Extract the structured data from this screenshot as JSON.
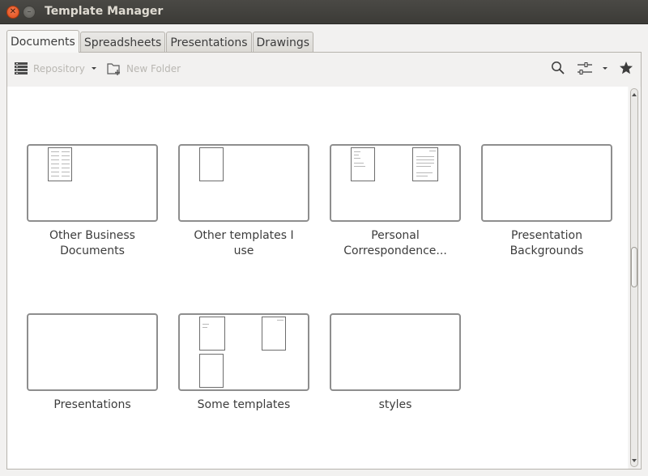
{
  "window": {
    "title": "Template Manager",
    "close_glyph": "✕",
    "min_glyph": "–"
  },
  "tabs": [
    {
      "label": "Documents",
      "active": true
    },
    {
      "label": "Spreadsheets",
      "active": false
    },
    {
      "label": "Presentations",
      "active": false
    },
    {
      "label": "Drawings",
      "active": false
    }
  ],
  "toolbar": {
    "repository_label": "Repository",
    "new_folder_label": "New Folder",
    "icons": [
      "list-icon",
      "chevron-down-icon",
      "new-folder-icon",
      "search-icon",
      "settings-sliders-icon",
      "chevron-down-icon",
      "star-icon"
    ]
  },
  "folders": [
    {
      "name": "Other Business Documents",
      "line1": "Other Business",
      "line2": "Documents"
    },
    {
      "name": "Other templates I use",
      "line1": "Other templates I",
      "line2": "use"
    },
    {
      "name": "Personal Correspondence...",
      "line1": "Personal",
      "line2": "Correspondence..."
    },
    {
      "name": "Presentation Backgrounds",
      "line1": "Presentation",
      "line2": "Backgrounds"
    },
    {
      "name": "Presentations",
      "line1": "Presentations",
      "line2": ""
    },
    {
      "name": "Some  templates",
      "line1": "Some  templates",
      "line2": ""
    },
    {
      "name": "styles",
      "line1": "styles",
      "line2": ""
    }
  ],
  "colors": {
    "titlebar": "#3c3b37",
    "close_button": "#df4a16",
    "thumbnail_border": "#8e8e8e"
  }
}
